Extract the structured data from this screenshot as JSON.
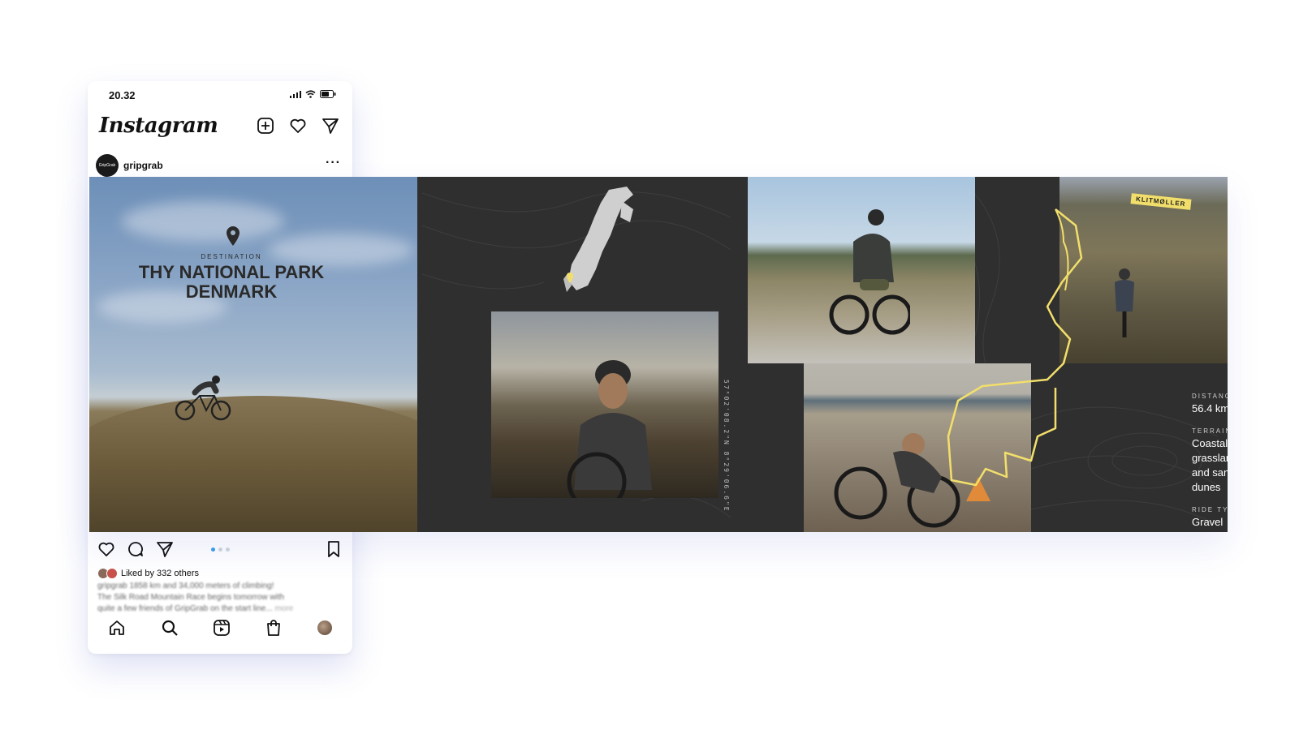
{
  "status_bar": {
    "time": "20.32"
  },
  "app": {
    "logo_text": "Instagram"
  },
  "post": {
    "username": "gripgrab",
    "avatar_text": "GripGrab",
    "more": "···",
    "likes_text": "Liked by 332 others",
    "caption_line1": "gripgrab 1858 km and 34,000 meters of climbing!",
    "caption_line2": "The Silk Road Mountain Race begins tomorrow with",
    "caption_line3": "quite a few friends of GripGrab on the start line...",
    "caption_more": "more",
    "carousel_index": 1,
    "carousel_count": 3
  },
  "carousel": {
    "destination_label": "DESTINATION",
    "title_line1": "THY NATIONAL PARK",
    "title_line2": "DENMARK",
    "coordinates": "57°02'08.2\"N 8°29'06.6\"E",
    "map_tag": "KLITMØLLER",
    "stats": {
      "distance_label": "DISTANCE",
      "distance_value": "56.4 km",
      "terrain_label": "TERRAIN",
      "terrain_line1": "Coastal grasslands",
      "terrain_line2": "and sand dunes",
      "ride_type_label": "RIDE TYPE",
      "ride_type_value": "Gravel"
    }
  },
  "colors": {
    "panel_dark": "#2f2f2f",
    "route_yellow": "#f2df6b",
    "carousel_active_dot": "#3aa0ef"
  },
  "icons": [
    "signal-icon",
    "wifi-icon",
    "battery-icon",
    "new-post-icon",
    "heart-icon",
    "send-icon",
    "like-icon",
    "comment-icon",
    "share-icon",
    "bookmark-icon",
    "home-icon",
    "search-icon",
    "reels-icon",
    "shop-icon",
    "location-pin-icon"
  ]
}
